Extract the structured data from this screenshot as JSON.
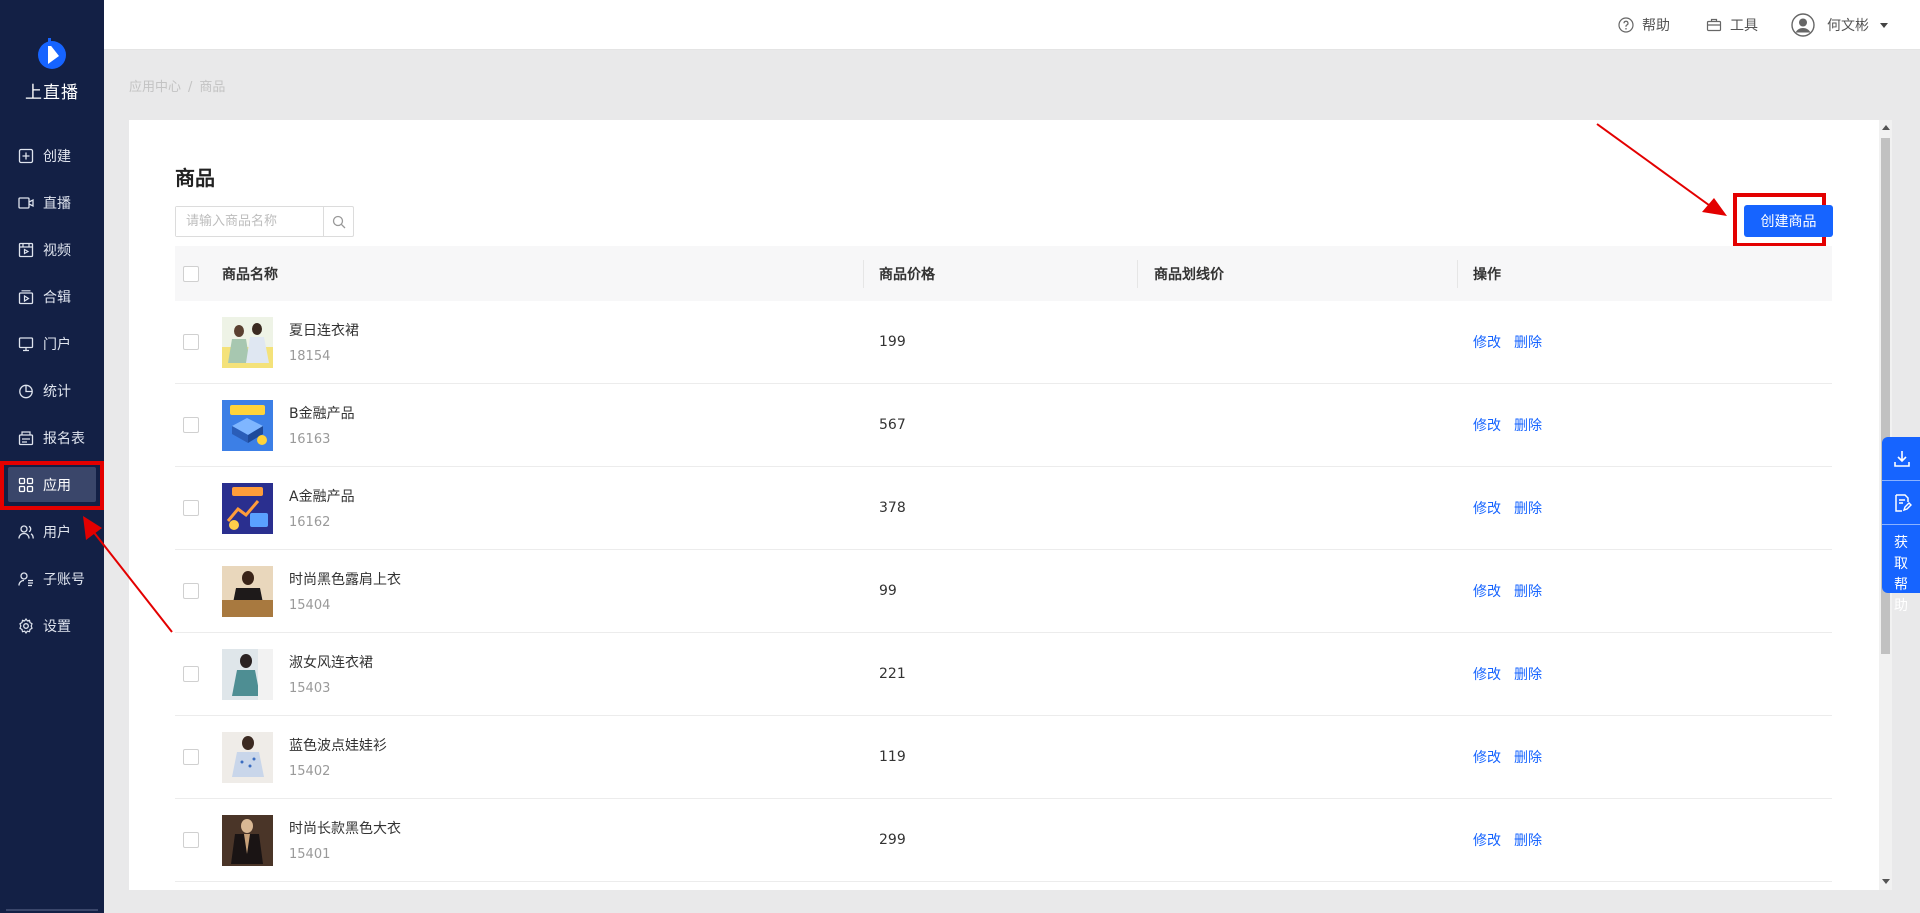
{
  "app": {
    "name": "上直播"
  },
  "sidebar": {
    "items": [
      {
        "label": "创建",
        "icon": "plus-square-icon"
      },
      {
        "label": "直播",
        "icon": "camera-icon"
      },
      {
        "label": "视频",
        "icon": "film-icon"
      },
      {
        "label": "合辑",
        "icon": "collection-icon"
      },
      {
        "label": "门户",
        "icon": "monitor-icon"
      },
      {
        "label": "统计",
        "icon": "pie-chart-icon"
      },
      {
        "label": "报名表",
        "icon": "form-icon"
      },
      {
        "label": "应用",
        "icon": "apps-grid-icon",
        "active": true
      },
      {
        "label": "用户",
        "icon": "users-icon"
      },
      {
        "label": "子账号",
        "icon": "sub-account-icon"
      },
      {
        "label": "设置",
        "icon": "gear-icon"
      }
    ]
  },
  "topbar": {
    "help": "帮助",
    "tools": "工具",
    "user": "何文彬"
  },
  "breadcrumb": {
    "parent": "应用中心",
    "separator": "/",
    "current": "商品"
  },
  "page": {
    "title": "商品",
    "search_placeholder": "请输入商品名称",
    "create_button": "创建商品"
  },
  "table": {
    "headers": {
      "name": "商品名称",
      "price": "商品价格",
      "strike_price": "商品划线价",
      "ops": "操作"
    },
    "actions": {
      "edit": "修改",
      "delete": "删除"
    },
    "rows": [
      {
        "name": "夏日连衣裙",
        "id": "18154",
        "price": "199",
        "strike_price": ""
      },
      {
        "name": "B金融产品",
        "id": "16163",
        "price": "567",
        "strike_price": ""
      },
      {
        "name": "A金融产品",
        "id": "16162",
        "price": "378",
        "strike_price": ""
      },
      {
        "name": "时尚黑色露肩上衣",
        "id": "15404",
        "price": "99",
        "strike_price": ""
      },
      {
        "name": "淑女风连衣裙",
        "id": "15403",
        "price": "221",
        "strike_price": ""
      },
      {
        "name": "蓝色波点娃娃衫",
        "id": "15402",
        "price": "119",
        "strike_price": ""
      },
      {
        "name": "时尚长款黑色大衣",
        "id": "15401",
        "price": "299",
        "strike_price": ""
      }
    ]
  },
  "float_help": {
    "label": "获取帮助"
  },
  "colors": {
    "sidebar": "#132045",
    "primary": "#1664ff",
    "annotation": "#e30000"
  }
}
